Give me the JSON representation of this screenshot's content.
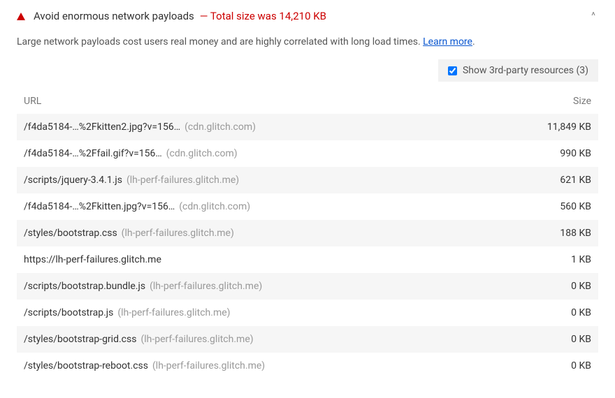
{
  "audit": {
    "title": "Avoid enormous network payloads",
    "summary": "— Total size was 14,210 KB",
    "description": "Large network payloads cost users real money and are highly correlated with long load times. ",
    "learn_more": "Learn more",
    "chevron": "^"
  },
  "thirdparty": {
    "label": "Show 3rd-party resources (3)",
    "checked": true
  },
  "table": {
    "header_url": "URL",
    "header_size": "Size",
    "rows": [
      {
        "url": "/f4da5184-…%2Fkitten2.jpg?v=156…",
        "host": "(cdn.glitch.com)",
        "size": "11,849 KB"
      },
      {
        "url": "/f4da5184-…%2Ffail.gif?v=156…",
        "host": "(cdn.glitch.com)",
        "size": "990 KB"
      },
      {
        "url": "/scripts/jquery-3.4.1.js",
        "host": "(lh-perf-failures.glitch.me)",
        "size": "621 KB"
      },
      {
        "url": "/f4da5184-…%2Fkitten.jpg?v=156…",
        "host": "(cdn.glitch.com)",
        "size": "560 KB"
      },
      {
        "url": "/styles/bootstrap.css",
        "host": "(lh-perf-failures.glitch.me)",
        "size": "188 KB"
      },
      {
        "url": "https://lh-perf-failures.glitch.me",
        "host": "",
        "size": "1 KB"
      },
      {
        "url": "/scripts/bootstrap.bundle.js",
        "host": "(lh-perf-failures.glitch.me)",
        "size": "0 KB"
      },
      {
        "url": "/scripts/bootstrap.js",
        "host": "(lh-perf-failures.glitch.me)",
        "size": "0 KB"
      },
      {
        "url": "/styles/bootstrap-grid.css",
        "host": "(lh-perf-failures.glitch.me)",
        "size": "0 KB"
      },
      {
        "url": "/styles/bootstrap-reboot.css",
        "host": "(lh-perf-failures.glitch.me)",
        "size": "0 KB"
      }
    ]
  }
}
